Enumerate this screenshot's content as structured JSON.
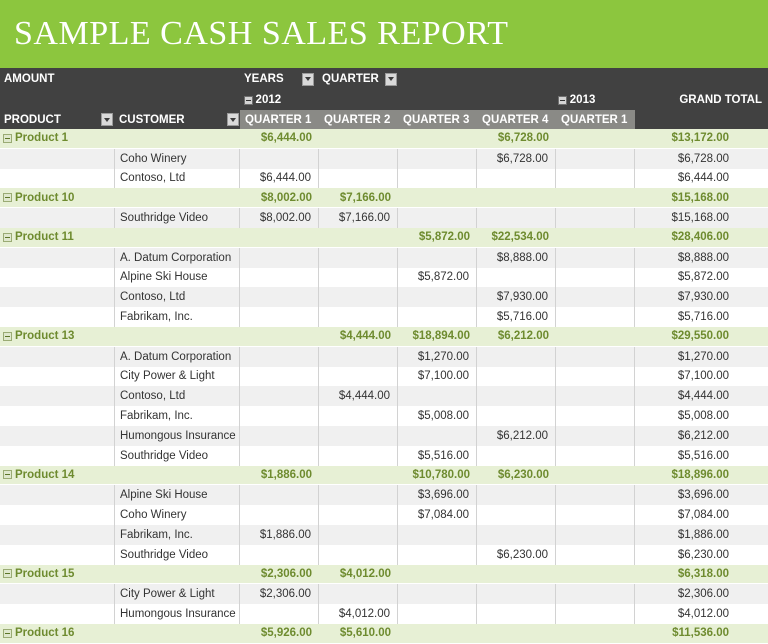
{
  "title": "SAMPLE CASH SALES REPORT",
  "header": {
    "amount_label": "AMOUNT",
    "years_label": "YEARS",
    "quarter_label": "QUARTER",
    "product_label": "PRODUCT",
    "customer_label": "CUSTOMER",
    "grand_total_label": "GRAND TOTAL",
    "years": [
      {
        "label": "2012"
      },
      {
        "label": "2013"
      }
    ],
    "quarters": [
      "QUARTER 1",
      "QUARTER 2",
      "QUARTER 3",
      "QUARTER 4",
      "QUARTER 1"
    ]
  },
  "colors": {
    "banner_green": "#8cc63e",
    "header_dark": "#414141",
    "header_gray_band": "#8a8a86",
    "group_row_bg": "#e7f0d5",
    "group_row_text": "#6e8b2f",
    "alt_row_bg": "#f0f0f0"
  },
  "rows": [
    {
      "type": "group",
      "name": "Product 1",
      "values": [
        "$6,444.00",
        "",
        "",
        "$6,728.00",
        ""
      ],
      "total": "$13,172.00"
    },
    {
      "type": "detail",
      "name": "Coho Winery",
      "values": [
        "",
        "",
        "",
        "$6,728.00",
        ""
      ],
      "total": "$6,728.00"
    },
    {
      "type": "detail",
      "name": "Contoso, Ltd",
      "values": [
        "$6,444.00",
        "",
        "",
        "",
        ""
      ],
      "total": "$6,444.00"
    },
    {
      "type": "group",
      "name": "Product 10",
      "values": [
        "$8,002.00",
        "$7,166.00",
        "",
        "",
        ""
      ],
      "total": "$15,168.00"
    },
    {
      "type": "detail",
      "name": "Southridge Video",
      "values": [
        "$8,002.00",
        "$7,166.00",
        "",
        "",
        ""
      ],
      "total": "$15,168.00"
    },
    {
      "type": "group",
      "name": "Product 11",
      "values": [
        "",
        "",
        "$5,872.00",
        "$22,534.00",
        ""
      ],
      "total": "$28,406.00"
    },
    {
      "type": "detail",
      "name": "A. Datum Corporation",
      "values": [
        "",
        "",
        "",
        "$8,888.00",
        ""
      ],
      "total": "$8,888.00"
    },
    {
      "type": "detail",
      "name": "Alpine Ski House",
      "values": [
        "",
        "",
        "$5,872.00",
        "",
        ""
      ],
      "total": "$5,872.00"
    },
    {
      "type": "detail",
      "name": "Contoso, Ltd",
      "values": [
        "",
        "",
        "",
        "$7,930.00",
        ""
      ],
      "total": "$7,930.00"
    },
    {
      "type": "detail",
      "name": "Fabrikam, Inc.",
      "values": [
        "",
        "",
        "",
        "$5,716.00",
        ""
      ],
      "total": "$5,716.00"
    },
    {
      "type": "group",
      "name": "Product 13",
      "values": [
        "",
        "$4,444.00",
        "$18,894.00",
        "$6,212.00",
        ""
      ],
      "total": "$29,550.00"
    },
    {
      "type": "detail",
      "name": "A. Datum Corporation",
      "values": [
        "",
        "",
        "$1,270.00",
        "",
        ""
      ],
      "total": "$1,270.00"
    },
    {
      "type": "detail",
      "name": "City Power & Light",
      "values": [
        "",
        "",
        "$7,100.00",
        "",
        ""
      ],
      "total": "$7,100.00"
    },
    {
      "type": "detail",
      "name": "Contoso, Ltd",
      "values": [
        "",
        "$4,444.00",
        "",
        "",
        ""
      ],
      "total": "$4,444.00"
    },
    {
      "type": "detail",
      "name": "Fabrikam, Inc.",
      "values": [
        "",
        "",
        "$5,008.00",
        "",
        ""
      ],
      "total": "$5,008.00"
    },
    {
      "type": "detail",
      "name": "Humongous Insurance",
      "values": [
        "",
        "",
        "",
        "$6,212.00",
        ""
      ],
      "total": "$6,212.00"
    },
    {
      "type": "detail",
      "name": "Southridge Video",
      "values": [
        "",
        "",
        "$5,516.00",
        "",
        ""
      ],
      "total": "$5,516.00"
    },
    {
      "type": "group",
      "name": "Product 14",
      "values": [
        "$1,886.00",
        "",
        "$10,780.00",
        "$6,230.00",
        ""
      ],
      "total": "$18,896.00"
    },
    {
      "type": "detail",
      "name": "Alpine Ski House",
      "values": [
        "",
        "",
        "$3,696.00",
        "",
        ""
      ],
      "total": "$3,696.00"
    },
    {
      "type": "detail",
      "name": "Coho Winery",
      "values": [
        "",
        "",
        "$7,084.00",
        "",
        ""
      ],
      "total": "$7,084.00"
    },
    {
      "type": "detail",
      "name": "Fabrikam, Inc.",
      "values": [
        "$1,886.00",
        "",
        "",
        "",
        ""
      ],
      "total": "$1,886.00"
    },
    {
      "type": "detail",
      "name": "Southridge Video",
      "values": [
        "",
        "",
        "",
        "$6,230.00",
        ""
      ],
      "total": "$6,230.00"
    },
    {
      "type": "group",
      "name": "Product 15",
      "values": [
        "$2,306.00",
        "$4,012.00",
        "",
        "",
        ""
      ],
      "total": "$6,318.00"
    },
    {
      "type": "detail",
      "name": "City Power & Light",
      "values": [
        "$2,306.00",
        "",
        "",
        "",
        ""
      ],
      "total": "$2,306.00"
    },
    {
      "type": "detail",
      "name": "Humongous Insurance",
      "values": [
        "",
        "$4,012.00",
        "",
        "",
        ""
      ],
      "total": "$4,012.00"
    },
    {
      "type": "group",
      "name": "Product 16",
      "values": [
        "$5,926.00",
        "$5,610.00",
        "",
        "",
        ""
      ],
      "total": "$11,536.00"
    }
  ]
}
